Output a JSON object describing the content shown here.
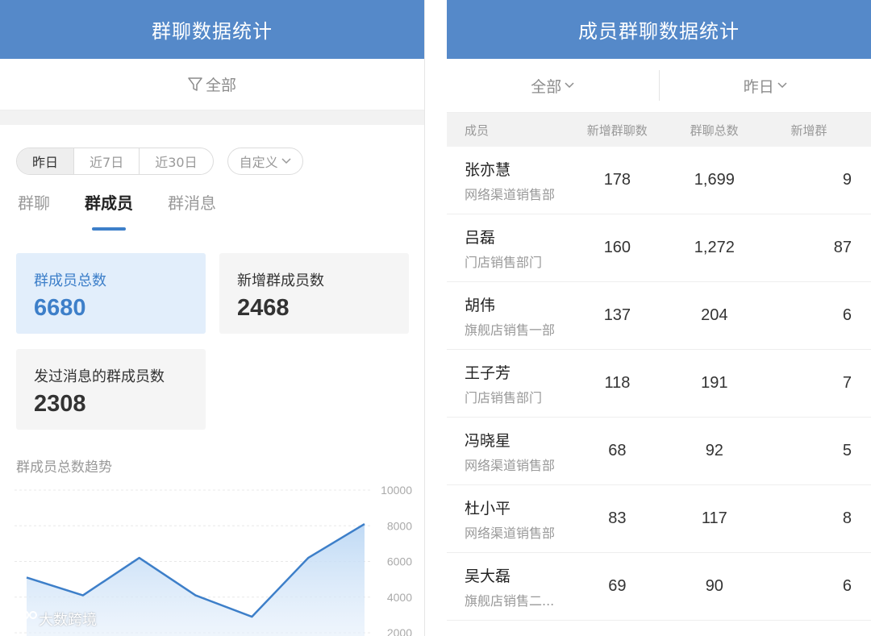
{
  "left": {
    "title": "群聊数据统计",
    "filter_label": "全部",
    "segments": [
      "昨日",
      "近7日",
      "近30日"
    ],
    "custom_label": "自定义",
    "tabs": [
      "群聊",
      "群成员",
      "群消息"
    ],
    "cards": [
      {
        "label": "群成员总数",
        "value": "6680"
      },
      {
        "label": "新增群成员数",
        "value": "2468"
      },
      {
        "label": "发过消息的群成员数",
        "value": "2308"
      }
    ],
    "trend_title": "群成员总数趋势",
    "chart_data": {
      "type": "area",
      "title": "",
      "xlabel": "",
      "ylabel": "",
      "y_ticks": [
        "10000",
        "8000",
        "6000",
        "4000",
        "2000"
      ],
      "ylim": [
        2000,
        10000
      ],
      "values": [
        5100,
        4100,
        6200,
        4100,
        2900,
        6200,
        8100
      ],
      "accent": "#3d7fc9"
    }
  },
  "right": {
    "title": "成员群聊数据统计",
    "filter_scope": "全部",
    "filter_date": "昨日",
    "columns": [
      "成员",
      "新增群聊数",
      "群聊总数",
      "新增群"
    ],
    "rows": [
      {
        "name": "张亦慧",
        "dept": "网络渠道销售部",
        "a": "178",
        "b": "1,699",
        "c": "9"
      },
      {
        "name": "吕磊",
        "dept": "门店销售部门",
        "a": "160",
        "b": "1,272",
        "c": "87"
      },
      {
        "name": "胡伟",
        "dept": "旗舰店销售一部",
        "a": "137",
        "b": "204",
        "c": "6"
      },
      {
        "name": "王子芳",
        "dept": "门店销售部门",
        "a": "118",
        "b": "191",
        "c": "7"
      },
      {
        "name": "冯晓星",
        "dept": "网络渠道销售部",
        "a": "68",
        "b": "92",
        "c": "5"
      },
      {
        "name": "杜小平",
        "dept": "网络渠道销售部",
        "a": "83",
        "b": "117",
        "c": "8"
      },
      {
        "name": "吴大磊",
        "dept": "旗舰店销售二...",
        "a": "69",
        "b": "90",
        "c": "6"
      }
    ]
  },
  "watermark": "大数跨境"
}
